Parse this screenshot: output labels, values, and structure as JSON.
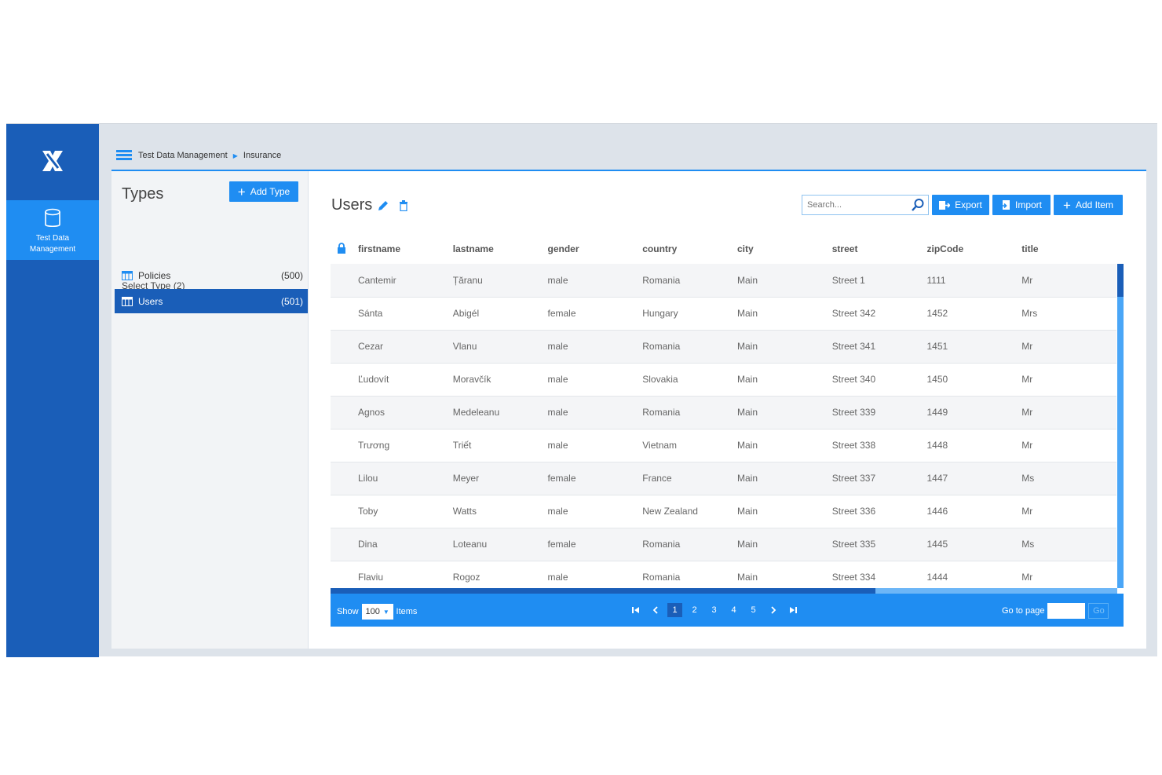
{
  "nav": {
    "active_item": "Test Data Management"
  },
  "breadcrumb": {
    "items": [
      "Test Data Management",
      "Insurance"
    ]
  },
  "types_panel": {
    "title": "Types",
    "add_button": "Add Type",
    "select_label": "Select Type (2)",
    "items": [
      {
        "name": "Policies",
        "count": "(500)",
        "selected": false
      },
      {
        "name": "Users",
        "count": "(501)",
        "selected": true
      }
    ]
  },
  "main": {
    "title": "Users",
    "search_placeholder": "Search...",
    "buttons": {
      "export": "Export",
      "import": "Import",
      "add_item": "Add Item"
    },
    "columns": [
      "firstname",
      "lastname",
      "gender",
      "country",
      "city",
      "street",
      "zipCode",
      "title"
    ],
    "rows": [
      [
        "Cantemir",
        "Țăranu",
        "male",
        "Romania",
        "Main",
        "Street 1",
        "1111",
        "Mr"
      ],
      [
        "Sánta",
        "Abigél",
        "female",
        "Hungary",
        "Main",
        "Street 342",
        "1452",
        "Mrs"
      ],
      [
        "Cezar",
        "Vlanu",
        "male",
        "Romania",
        "Main",
        "Street 341",
        "1451",
        "Mr"
      ],
      [
        "Ľudovít",
        "Moravčík",
        "male",
        "Slovakia",
        "Main",
        "Street 340",
        "1450",
        "Mr"
      ],
      [
        "Agnos",
        "Medeleanu",
        "male",
        "Romania",
        "Main",
        "Street 339",
        "1449",
        "Mr"
      ],
      [
        "Trương",
        "Triết",
        "male",
        "Vietnam",
        "Main",
        "Street 338",
        "1448",
        "Mr"
      ],
      [
        "Lilou",
        "Meyer",
        "female",
        "France",
        "Main",
        "Street 337",
        "1447",
        "Ms"
      ],
      [
        "Toby",
        "Watts",
        "male",
        "New Zealand",
        "Main",
        "Street 336",
        "1446",
        "Mr"
      ],
      [
        "Dina",
        "Loteanu",
        "female",
        "Romania",
        "Main",
        "Street 335",
        "1445",
        "Ms"
      ],
      [
        "Flaviu",
        "Rogoz",
        "male",
        "Romania",
        "Main",
        "Street 334",
        "1444",
        "Mr"
      ]
    ]
  },
  "pager": {
    "show_label": "Show",
    "page_size": "100",
    "items_label": "Items",
    "pages": [
      "1",
      "2",
      "3",
      "4",
      "5"
    ],
    "current_page": "1",
    "goto_label": "Go to page",
    "go_button": "Go"
  },
  "colors": {
    "primary": "#1f8df2",
    "dark": "#1a5eb8",
    "nav_bg": "#1a5eb8"
  }
}
